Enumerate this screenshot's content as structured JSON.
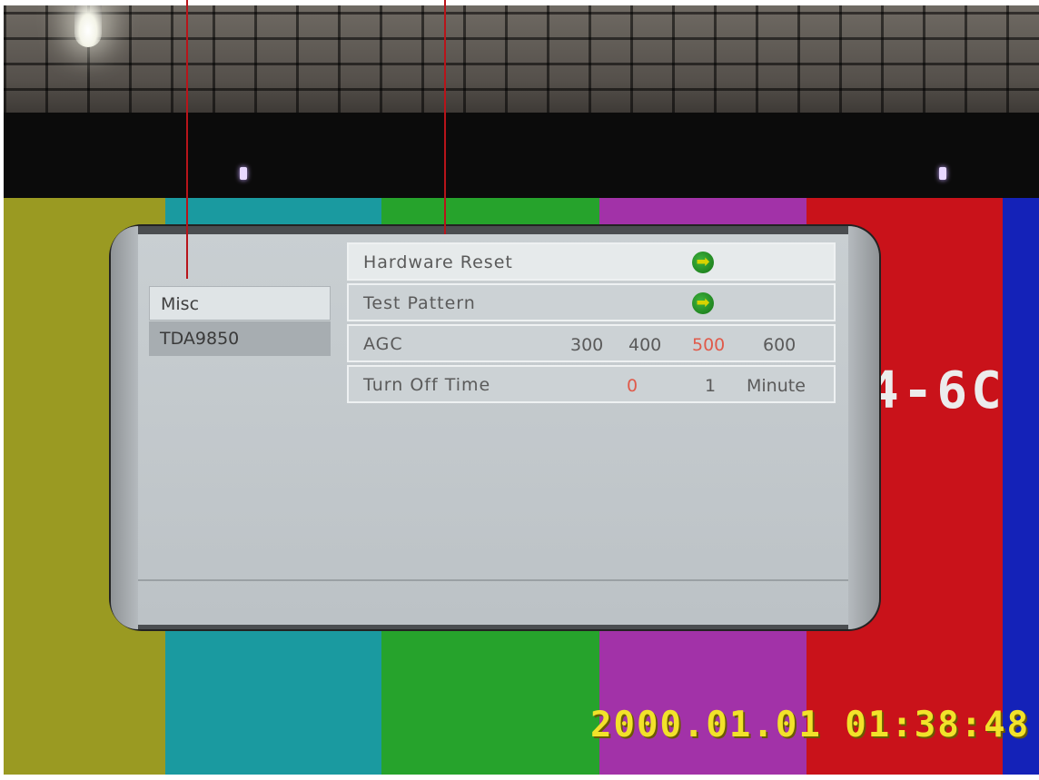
{
  "menu": {
    "tabs": [
      {
        "label": "Misc",
        "selected": true
      },
      {
        "label": "TDA9850",
        "selected": false
      }
    ],
    "items": [
      {
        "label": "Hardware Reset",
        "icon": "enter-arrow-icon"
      },
      {
        "label": "Test Pattern",
        "icon": "enter-arrow-icon"
      },
      {
        "label": "AGC",
        "options": [
          "300",
          "400",
          "500",
          "600"
        ],
        "selected_option": "500"
      },
      {
        "label": "Turn Off Time",
        "options": [
          "0",
          "1"
        ],
        "unit": "Minute",
        "selected_option": "0"
      }
    ]
  },
  "background": {
    "channel_text": "4-6C",
    "timestamp": "2000.01.01  01:38:48"
  },
  "colors": {
    "selected_option": "#e05a4a",
    "arrow_icon_bg": "#1f8f1f",
    "arrow_glyph": "#d8d300",
    "timestamp": "#f2e22a",
    "callout_line": "#b8141a"
  }
}
